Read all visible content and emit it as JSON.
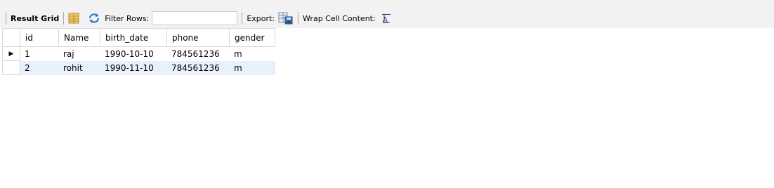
{
  "toolbar": {
    "result_grid_label": "Result Grid",
    "filter_rows_label": "Filter Rows:",
    "filter_value": "",
    "export_label": "Export:",
    "wrap_label": "Wrap Cell Content:",
    "icons": [
      "form-editor-icon",
      "refresh-icon",
      "export-icon",
      "wrap-text-icon"
    ]
  },
  "grid": {
    "columns": [
      "id",
      "Name",
      "birth_date",
      "phone",
      "gender"
    ],
    "rows": [
      {
        "id": "1",
        "name": "raj",
        "birth_date": "1990-10-10",
        "phone": "784561236",
        "gender": "m"
      },
      {
        "id": "2",
        "name": "rohit",
        "birth_date": "1990-11-10",
        "phone": "784561236",
        "gender": "m"
      }
    ],
    "current_row_marker": "▶"
  },
  "colors": {
    "toolbar_bg": "#f2f2f2",
    "alt_row": "#e8f0fb",
    "grid_line": "#d9d9d9"
  }
}
